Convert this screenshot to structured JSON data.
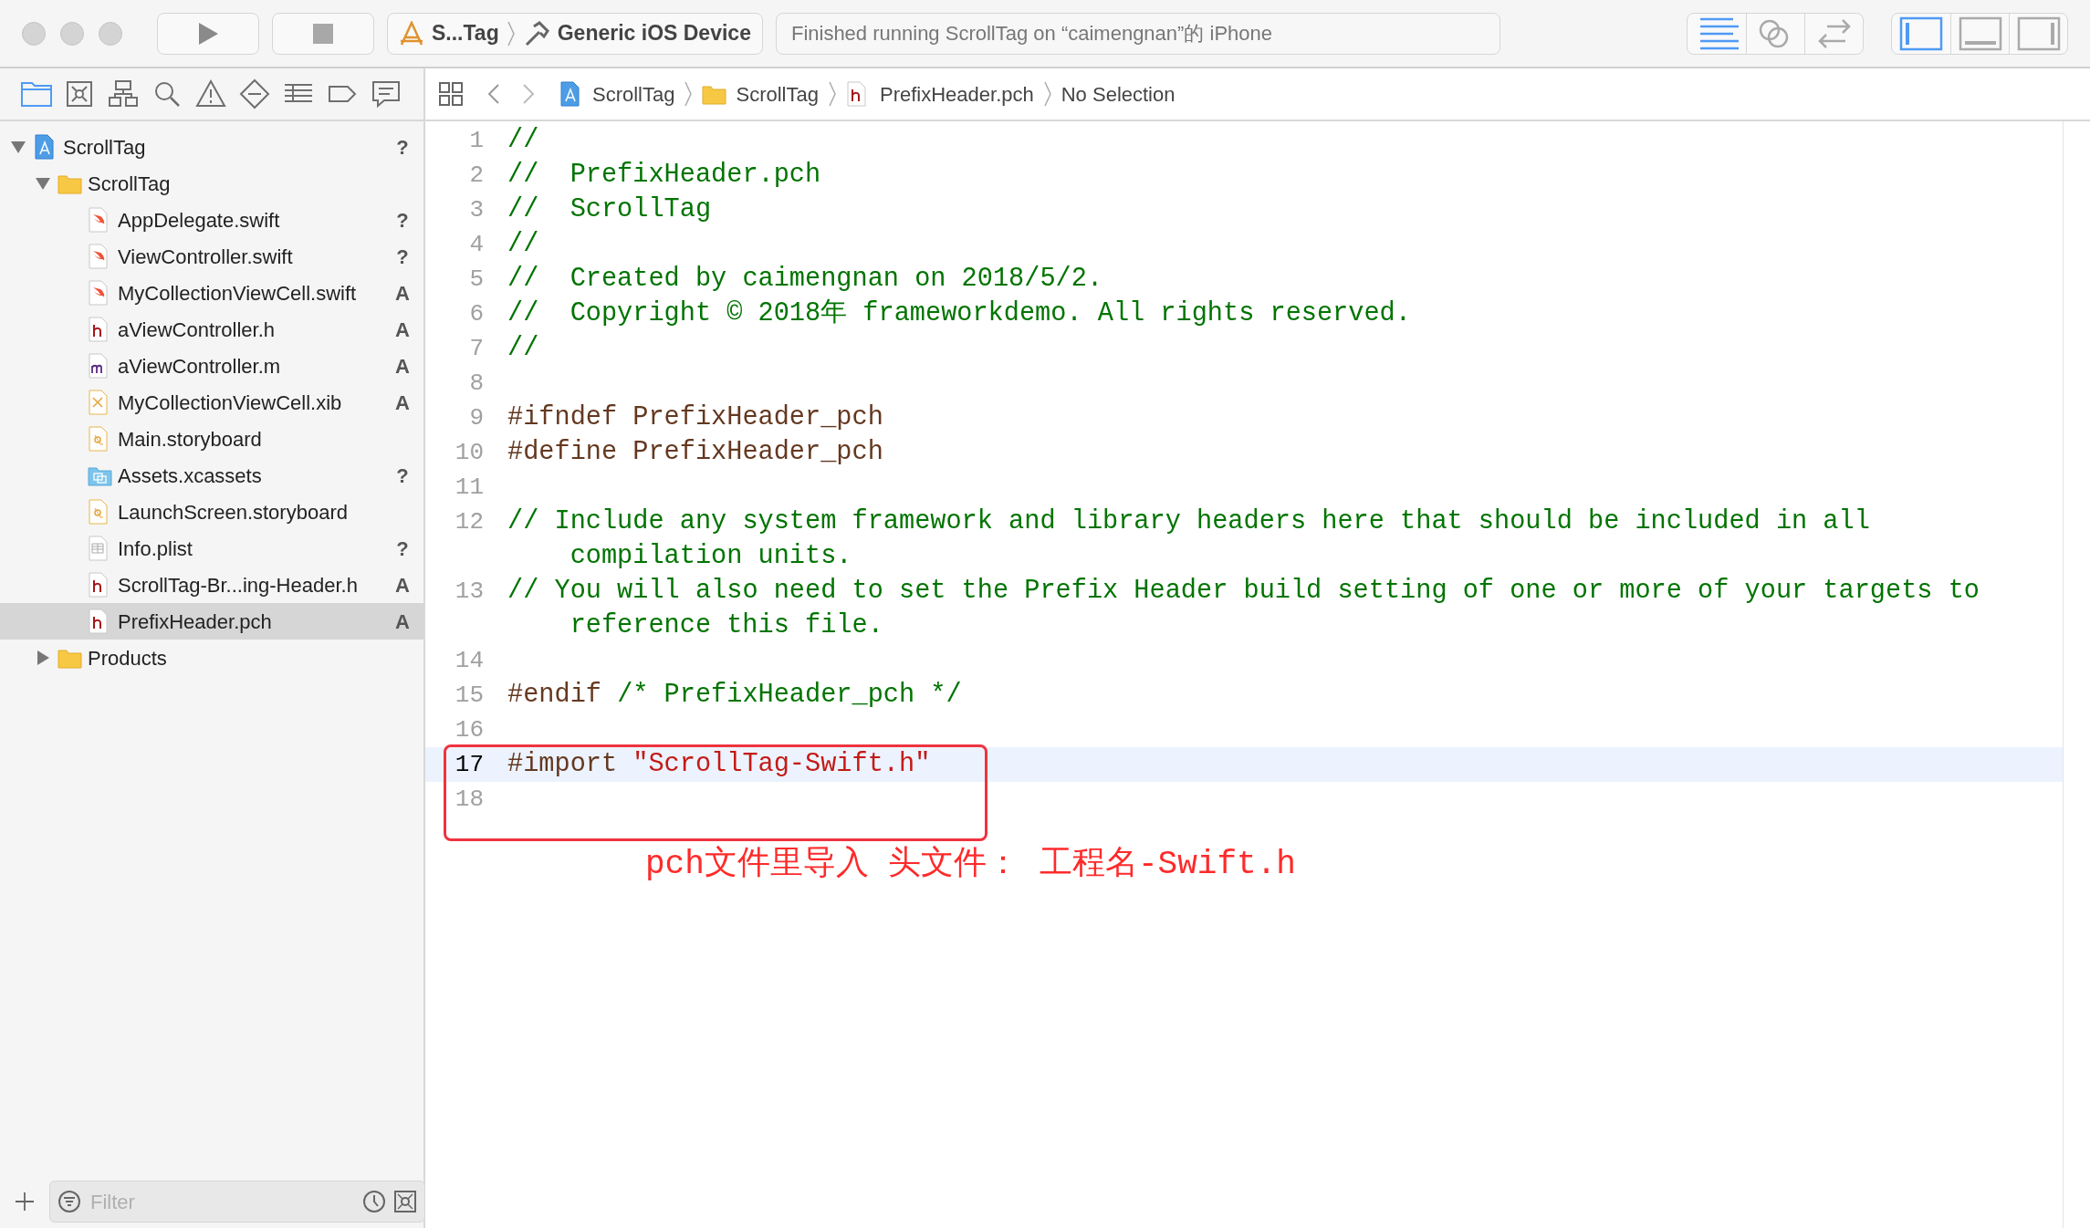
{
  "toolbar": {
    "scheme": "S...Tag",
    "destination": "Generic iOS Device",
    "activity": "Finished running ScrollTag on “caimengnan”的 iPhone",
    "editor_modes": [
      {
        "kind": "standard",
        "selected": true
      },
      {
        "kind": "assistant",
        "selected": false
      },
      {
        "kind": "version",
        "selected": false
      }
    ],
    "panels": [
      {
        "kind": "navigator",
        "on": true
      },
      {
        "kind": "debug",
        "on": false
      },
      {
        "kind": "utilities",
        "on": false
      }
    ]
  },
  "navigator_tabs": [
    {
      "kind": "project",
      "selected": true
    },
    {
      "kind": "source-control",
      "selected": false
    },
    {
      "kind": "symbol",
      "selected": false
    },
    {
      "kind": "find",
      "selected": false
    },
    {
      "kind": "issue",
      "selected": false
    },
    {
      "kind": "test",
      "selected": false
    },
    {
      "kind": "debug",
      "selected": false
    },
    {
      "kind": "breakpoint",
      "selected": false
    },
    {
      "kind": "report",
      "selected": false
    }
  ],
  "jump_bar": [
    {
      "kind": "project",
      "label": "ScrollTag"
    },
    {
      "kind": "folder",
      "label": "ScrollTag"
    },
    {
      "kind": "header",
      "label": "PrefixHeader.pch"
    },
    {
      "kind": "plain",
      "label": "No Selection"
    }
  ],
  "tree": [
    {
      "name": "ScrollTag",
      "kind": "project",
      "status": "?",
      "selected": false,
      "expanded": true,
      "children": [
        {
          "name": "ScrollTag",
          "kind": "folder",
          "selected": false,
          "expanded": true,
          "children": [
            {
              "name": "AppDelegate.swift",
              "kind": "swift",
              "status": "?",
              "selected": false
            },
            {
              "name": "ViewController.swift",
              "kind": "swift",
              "status": "?",
              "selected": false
            },
            {
              "name": "MyCollectionViewCell.swift",
              "kind": "swift",
              "status": "A",
              "selected": false
            },
            {
              "name": "aViewController.h",
              "kind": "h",
              "status": "A",
              "selected": false
            },
            {
              "name": "aViewController.m",
              "kind": "m",
              "status": "A",
              "selected": false
            },
            {
              "name": "MyCollectionViewCell.xib",
              "kind": "xib",
              "status": "A",
              "selected": false
            },
            {
              "name": "Main.storyboard",
              "kind": "storyboard",
              "selected": false
            },
            {
              "name": "Assets.xcassets",
              "kind": "assets",
              "status": "?",
              "selected": false
            },
            {
              "name": "LaunchScreen.storyboard",
              "kind": "storyboard",
              "selected": false
            },
            {
              "name": "Info.plist",
              "kind": "plist",
              "status": "?",
              "selected": false
            },
            {
              "name": "ScrollTag-Br...ing-Header.h",
              "kind": "h",
              "status": "A",
              "selected": false
            },
            {
              "name": "PrefixHeader.pch",
              "kind": "h",
              "status": "A",
              "selected": true
            }
          ]
        },
        {
          "name": "Products",
          "kind": "folder",
          "selected": false,
          "expanded": false
        }
      ]
    }
  ],
  "filter": {
    "placeholder": "Filter"
  },
  "code": [
    {
      "number": "1",
      "current": false,
      "segments": [
        {
          "kind": "comment",
          "text": "//"
        }
      ]
    },
    {
      "number": "2",
      "current": false,
      "segments": [
        {
          "kind": "comment",
          "text": "//  PrefixHeader.pch"
        }
      ]
    },
    {
      "number": "3",
      "current": false,
      "segments": [
        {
          "kind": "comment",
          "text": "//  ScrollTag"
        }
      ]
    },
    {
      "number": "4",
      "current": false,
      "segments": [
        {
          "kind": "comment",
          "text": "//"
        }
      ]
    },
    {
      "number": "5",
      "current": false,
      "segments": [
        {
          "kind": "comment",
          "text": "//  Created by caimengnan on 2018/5/2."
        }
      ]
    },
    {
      "number": "6",
      "current": false,
      "segments": [
        {
          "kind": "comment",
          "text": "//  Copyright © 2018年 frameworkdemo. All rights reserved."
        }
      ]
    },
    {
      "number": "7",
      "current": false,
      "segments": [
        {
          "kind": "comment",
          "text": "//"
        }
      ]
    },
    {
      "number": "8",
      "current": false
    },
    {
      "number": "9",
      "current": false,
      "segments": [
        {
          "kind": "preprocessor",
          "text": "#ifndef PrefixHeader_pch"
        }
      ]
    },
    {
      "number": "10",
      "current": false,
      "segments": [
        {
          "kind": "preprocessor",
          "text": "#define PrefixHeader_pch"
        }
      ]
    },
    {
      "number": "11",
      "current": false
    },
    {
      "number": "12",
      "current": false,
      "segments": [
        {
          "kind": "comment",
          "text": "// Include any system framework and library headers here that should be included in all compilation units."
        }
      ]
    },
    {
      "number": "13",
      "current": false,
      "segments": [
        {
          "kind": "comment",
          "text": "// You will also need to set the Prefix Header build setting of one or more of your targets to reference this file."
        }
      ]
    },
    {
      "number": "14",
      "current": false
    },
    {
      "number": "15",
      "current": false,
      "segments": [
        {
          "kind": "preprocessor",
          "text": "#endif "
        },
        {
          "kind": "comment",
          "text": "/* PrefixHeader_pch */"
        }
      ]
    },
    {
      "number": "16",
      "current": false
    },
    {
      "number": "17",
      "current": true,
      "segments": [
        {
          "kind": "preprocessor",
          "text": "#import "
        },
        {
          "kind": "string",
          "text": "\"ScrollTag-Swift.h\""
        }
      ]
    },
    {
      "number": "18",
      "current": false
    }
  ],
  "annotation": {
    "text": "pch文件里导入 头文件： 工程名-Swift.h"
  }
}
